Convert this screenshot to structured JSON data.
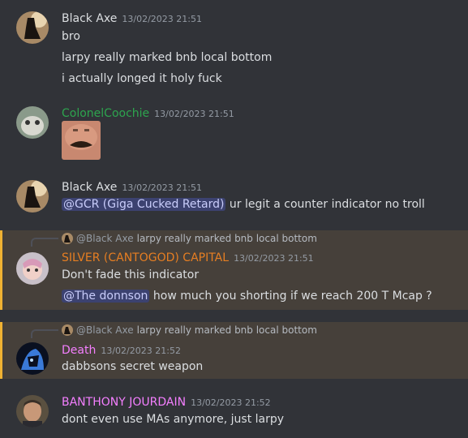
{
  "messages": [
    {
      "author": "Black Axe",
      "author_color": "#dbdee1",
      "timestamp": "13/02/2023 21:51",
      "lines": [
        "bro",
        "larpy really marked bnb local bottom",
        "i actually longed it holy fuck"
      ]
    },
    {
      "author": "ColonelCoochie",
      "author_color": "#2da44e",
      "timestamp": "13/02/2023 21:51",
      "attachment": "mustache-face-emote"
    },
    {
      "author": "Black Axe",
      "author_color": "#dbdee1",
      "timestamp": "13/02/2023 21:51",
      "mention": "@GCR (Giga Cucked Retard)",
      "text": "ur legit a counter indicator no troll"
    },
    {
      "reply_to_user": "@Black Axe",
      "reply_to_text": "larpy really marked bnb local bottom",
      "author": "SILVER (CANTOGOD) CAPITAL",
      "author_color": "#e67e22",
      "timestamp": "13/02/2023 21:51",
      "line1": "Don't fade this indicator",
      "mention": "@The donnson",
      "text": "how much you shorting if we reach 200 T Mcap ?"
    },
    {
      "reply_to_user": "@Black Axe",
      "reply_to_text": "larpy really marked bnb local bottom",
      "author": "Death",
      "author_color": "#f47fff",
      "timestamp": "13/02/2023 21:52",
      "line1": "dabbsons secret weapon"
    },
    {
      "author": "BANTHONY JOURDAIN",
      "author_color": "#f47fff",
      "timestamp": "13/02/2023 21:52",
      "line1": "dont even use MAs anymore, just larpy"
    }
  ]
}
